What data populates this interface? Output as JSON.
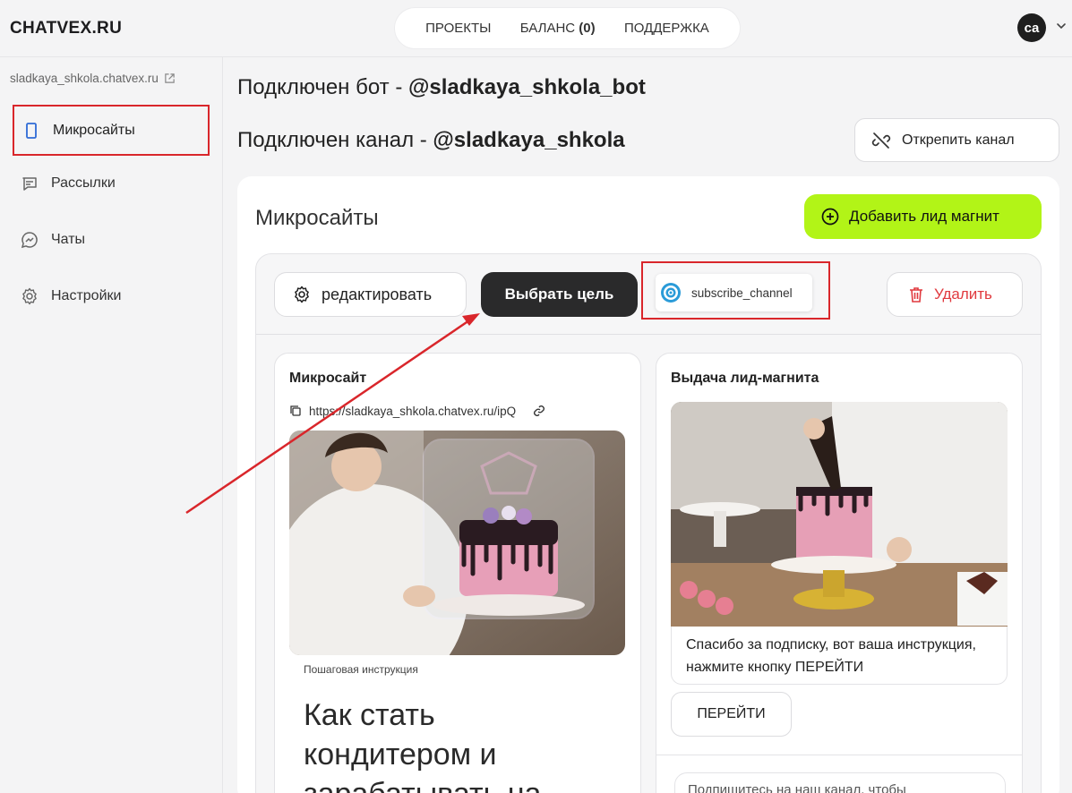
{
  "app": {
    "logo": "CHATVEX.RU"
  },
  "topnav": {
    "projects": "ПРОЕКТЫ",
    "balance_label": "БАЛАНС",
    "balance_value": "(0)",
    "support": "ПОДДЕРЖКА"
  },
  "user": {
    "initials": "ca"
  },
  "sidebar": {
    "domain": "sladkaya_shkola.chatvex.ru",
    "items": [
      {
        "label": "Микросайты",
        "icon": "phone-icon"
      },
      {
        "label": "Рассылки",
        "icon": "message-icon"
      },
      {
        "label": "Чаты",
        "icon": "messenger-icon"
      },
      {
        "label": "Настройки",
        "icon": "gear-icon"
      }
    ]
  },
  "header": {
    "bot_prefix": "Подключен бот - ",
    "bot_name": "@sladkaya_shkola_bot",
    "channel_prefix": "Подключен канал - ",
    "channel_name": "@sladkaya_shkola",
    "unpin_label": "Открепить канал"
  },
  "panel": {
    "title": "Микросайты",
    "add_label": "Добавить лид магнит",
    "edit_label": "редактировать",
    "goal_label": "Выбрать цель",
    "goal_value": "subscribe_channel",
    "delete_label": "Удалить"
  },
  "microsite": {
    "title": "Микросайт",
    "url": "https://sladkaya_shkola.chatvex.ru/ipQ",
    "caption": "Пошаговая инструкция",
    "headline": "Как стать кондитером и зарабатывать на"
  },
  "leadmagnet": {
    "title": "Выдача лид-магнита",
    "message": "Спасибо за подписку, вот ваша инструкция, нажмите кнопку ПЕРЕЙТИ",
    "button": "ПЕРЕЙТИ",
    "bottom_text": "Подпишитесь на наш канал, чтобы"
  },
  "colors": {
    "accent_green": "#b2f417",
    "highlight_red": "#d9262b",
    "delete_red": "#e0393e",
    "dark_button": "#2a2a2b"
  }
}
